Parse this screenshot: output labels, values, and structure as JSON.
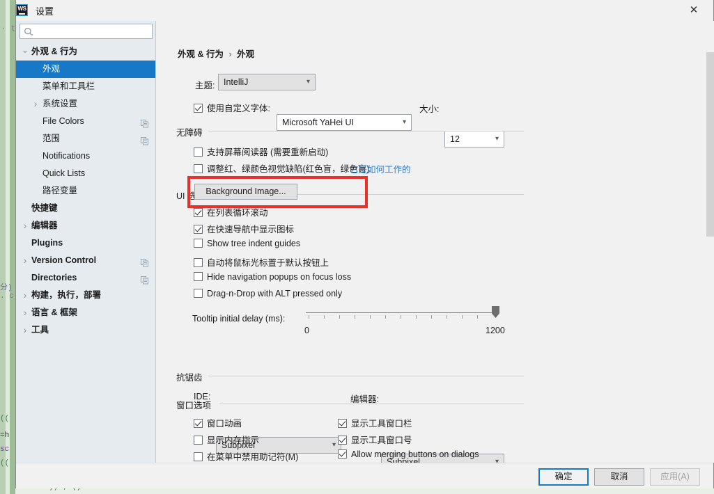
{
  "window": {
    "title": "设置",
    "logo_text": "WS",
    "close_icon": "close-icon"
  },
  "sidebar": {
    "search": {
      "value": "",
      "placeholder": "",
      "icon": "search-icon"
    },
    "items": [
      {
        "label": "外观 & 行为",
        "level": 0,
        "arrow": "chevron-down-icon",
        "selected": false,
        "copy": false
      },
      {
        "label": "外观",
        "level": 1,
        "arrow": "",
        "selected": true,
        "copy": false
      },
      {
        "label": "菜单和工具栏",
        "level": 1,
        "arrow": "",
        "selected": false,
        "copy": false
      },
      {
        "label": "系统设置",
        "level": 1,
        "arrow": "chevron-right-icon",
        "selected": false,
        "copy": false
      },
      {
        "label": "File Colors",
        "level": 1,
        "arrow": "",
        "selected": false,
        "copy": true
      },
      {
        "label": "范围",
        "level": 1,
        "arrow": "",
        "selected": false,
        "copy": true
      },
      {
        "label": "Notifications",
        "level": 1,
        "arrow": "",
        "selected": false,
        "copy": false
      },
      {
        "label": "Quick Lists",
        "level": 1,
        "arrow": "",
        "selected": false,
        "copy": false
      },
      {
        "label": "路径变量",
        "level": 1,
        "arrow": "",
        "selected": false,
        "copy": false
      },
      {
        "label": "快捷键",
        "level": 0,
        "arrow": "",
        "selected": false,
        "copy": false
      },
      {
        "label": "编辑器",
        "level": 0,
        "arrow": "chevron-right-icon",
        "selected": false,
        "copy": false
      },
      {
        "label": "Plugins",
        "level": 0,
        "arrow": "",
        "selected": false,
        "copy": false
      },
      {
        "label": "Version Control",
        "level": 0,
        "arrow": "chevron-right-icon",
        "selected": false,
        "copy": true
      },
      {
        "label": "Directories",
        "level": 0,
        "arrow": "",
        "selected": false,
        "copy": true
      },
      {
        "label": "构建，执行，部署",
        "level": 0,
        "arrow": "chevron-right-icon",
        "selected": false,
        "copy": false
      },
      {
        "label": "语言 & 框架",
        "level": 0,
        "arrow": "chevron-right-icon",
        "selected": false,
        "copy": false
      },
      {
        "label": "工具",
        "level": 0,
        "arrow": "chevron-right-icon",
        "selected": false,
        "copy": false
      }
    ],
    "help_label": "?"
  },
  "content": {
    "breadcrumb": {
      "parent": "外观 & 行为",
      "separator": "›",
      "current": "外观"
    },
    "theme": {
      "label": "主题:",
      "value": "IntelliJ"
    },
    "custom_font": {
      "checkbox_label": "使用自定义字体:",
      "checked": true,
      "font_value": "Microsoft YaHei UI",
      "size_label": "大小:",
      "size_value": "12"
    },
    "accessibility": {
      "group_title": "无障碍",
      "options": [
        {
          "label": "支持屏幕阅读器 (需要重新启动)",
          "checked": false
        },
        {
          "label": "调整红、绿颜色视觉缺陷(红色盲，绿色盲)",
          "checked": false
        }
      ],
      "link_text": "它是如何工作的"
    },
    "ui_options": {
      "group_title": "UI 选项",
      "background_image_button": "Background Image...",
      "options": [
        {
          "label": "在列表循环滚动",
          "checked": true
        },
        {
          "label": "在快速导航中显示图标",
          "checked": true
        },
        {
          "label": "Show tree indent guides",
          "checked": false
        },
        {
          "label": "自动将鼠标光标置于默认按钮上",
          "checked": false
        },
        {
          "label": "Hide navigation popups on focus loss",
          "checked": false
        },
        {
          "label": "Drag-n-Drop with ALT pressed only",
          "checked": false
        }
      ],
      "tooltip_slider": {
        "label": "Tooltip initial delay (ms):",
        "min_label": "0",
        "max_label": "1200",
        "min": 0,
        "max": 1200,
        "value": 1200
      }
    },
    "antialiasing": {
      "group_title": "抗锯齿",
      "ide_label": "IDE:",
      "ide_value": "Subpixel",
      "editor_label": "编辑器:",
      "editor_value": "Subpixel"
    },
    "window_options": {
      "group_title": "窗口选项",
      "left_column": [
        {
          "label": "窗口动画",
          "checked": true
        },
        {
          "label": "显示内存指示",
          "checked": false
        },
        {
          "label": "在菜单中禁用助记符(M)",
          "checked": false
        }
      ],
      "right_column": [
        {
          "label": "显示工具窗口栏",
          "checked": true
        },
        {
          "label": "显示工具窗口号",
          "checked": true
        },
        {
          "label": "Allow merging buttons on dialogs",
          "checked": true
        }
      ]
    }
  },
  "footer": {
    "ok_label": "确定",
    "cancel_label": "取消",
    "apply_label": "应用(A)",
    "apply_disabled": true
  },
  "annotation": {
    "color": "#e8312a",
    "target": "Background Image..."
  }
}
